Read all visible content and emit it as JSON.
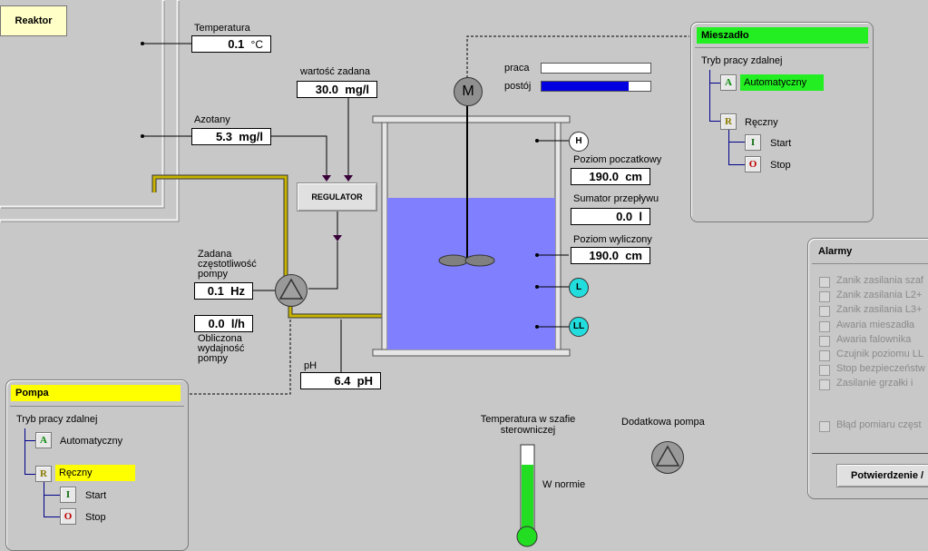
{
  "reactor": {
    "title": "Reaktor"
  },
  "temperature": {
    "label": "Temperatura",
    "value": "0.1",
    "unit": "°C"
  },
  "nitrates": {
    "label": "Azotany",
    "value": "5.3",
    "unit": "mg/l"
  },
  "setpoint": {
    "label": "wartość zadana",
    "value": "30.0",
    "unit": "mg/l"
  },
  "regulator": {
    "label": "REGULATOR"
  },
  "pump_freq": {
    "label_lines": [
      "Zadana",
      "częstotliwość",
      "pompy"
    ],
    "value": "0.1",
    "unit": "Hz"
  },
  "pump_flow": {
    "value": "0.0",
    "unit": "l/h",
    "label_lines": [
      "Obliczona",
      "wydajność",
      "pompy"
    ]
  },
  "ph": {
    "label": "pH",
    "value": "6.4",
    "unit": "pH"
  },
  "tank": {
    "initial_level": {
      "label": "Poziom poczatkowy",
      "value": "190.0",
      "unit": "cm"
    },
    "flow_sum": {
      "label": "Sumator przepływu",
      "value": "0.0",
      "unit": "l"
    },
    "calc_level": {
      "label": "Poziom wyliczony",
      "value": "190.0",
      "unit": "cm"
    },
    "sensor_h": "H",
    "sensor_l": "L",
    "sensor_ll": "LL",
    "fill_color": "#8080ff"
  },
  "motor": {
    "symbol": "M",
    "work_label": "praca",
    "idle_label": "postój",
    "work_fraction": 0.0,
    "idle_fraction": 0.8,
    "bar_color": "#0000e0"
  },
  "mixer_panel": {
    "title": "Mieszadło",
    "title_bg": "#22ee22",
    "mode_label": "Tryb pracy zdalnej",
    "auto_letter": "A",
    "auto_label": "Automatyczny",
    "manual_letter": "R",
    "manual_label": "Ręczny",
    "start_letter": "I",
    "start_label": "Start",
    "stop_letter": "O",
    "stop_label": "Stop"
  },
  "pump_panel": {
    "title": "Pompa",
    "title_bg": "#ffff00",
    "mode_label": "Tryb pracy zdalnej",
    "auto_letter": "A",
    "auto_label": "Automatyczny",
    "manual_letter": "R",
    "manual_label": "Ręczny",
    "start_letter": "I",
    "start_label": "Start",
    "stop_letter": "O",
    "stop_label": "Stop"
  },
  "alarms": {
    "title": "Alarmy",
    "items": [
      "Zanik zasilania szaf",
      "Zanik zasilania L2+",
      "Zanik zasilania L3+",
      "Awaria mieszadła",
      "Awaria falownika",
      "Czujnik poziomu LL",
      "Stop bezpieczeństw",
      "Zasilanie grzałki i"
    ],
    "extra_item": "Błąd pomiaru częst",
    "confirm_label": "Potwierdzenie /"
  },
  "cabinet_temp": {
    "label_lines": [
      "Temperatura w szafie",
      "sterowniczej"
    ],
    "status": "W normie",
    "level_fraction": 0.78,
    "color": "#22dd22"
  },
  "extra_pump": {
    "label": "Dodatkowa pompa"
  }
}
